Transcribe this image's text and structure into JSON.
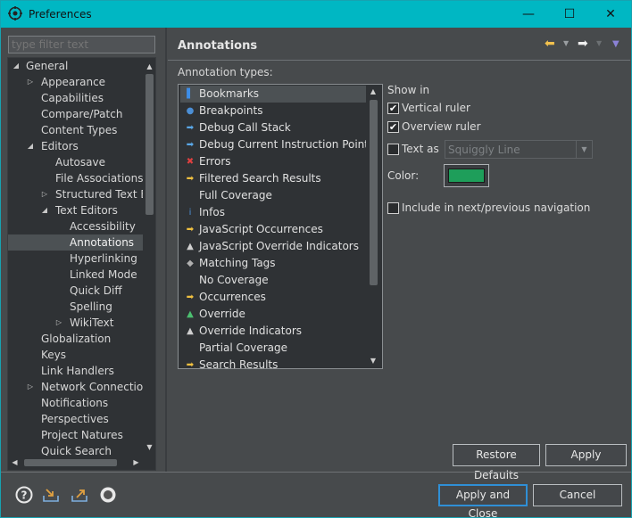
{
  "window": {
    "title": "Preferences",
    "minimize_glyph": "—",
    "maximize_glyph": "☐",
    "close_glyph": "✕"
  },
  "filter": {
    "placeholder": "type filter text"
  },
  "tree": {
    "items": [
      {
        "label": "General",
        "twisty": "expanded",
        "level": 0
      },
      {
        "label": "Appearance",
        "twisty": "collapsed",
        "level": 1
      },
      {
        "label": "Capabilities",
        "twisty": "none",
        "level": 1
      },
      {
        "label": "Compare/Patch",
        "twisty": "none",
        "level": 1
      },
      {
        "label": "Content Types",
        "twisty": "none",
        "level": 1
      },
      {
        "label": "Editors",
        "twisty": "expanded",
        "level": 1
      },
      {
        "label": "Autosave",
        "twisty": "none",
        "level": 2
      },
      {
        "label": "File Associations",
        "twisty": "none",
        "level": 2
      },
      {
        "label": "Structured Text Ed",
        "twisty": "collapsed",
        "level": 2
      },
      {
        "label": "Text Editors",
        "twisty": "expanded",
        "level": 2
      },
      {
        "label": "Accessibility",
        "twisty": "none",
        "level": 3
      },
      {
        "label": "Annotations",
        "twisty": "none",
        "level": 3,
        "selected": true
      },
      {
        "label": "Hyperlinking",
        "twisty": "none",
        "level": 3
      },
      {
        "label": "Linked Mode",
        "twisty": "none",
        "level": 3
      },
      {
        "label": "Quick Diff",
        "twisty": "none",
        "level": 3
      },
      {
        "label": "Spelling",
        "twisty": "none",
        "level": 3
      },
      {
        "label": "WikiText",
        "twisty": "collapsed",
        "level": 3
      },
      {
        "label": "Globalization",
        "twisty": "none",
        "level": 1
      },
      {
        "label": "Keys",
        "twisty": "none",
        "level": 1
      },
      {
        "label": "Link Handlers",
        "twisty": "none",
        "level": 1
      },
      {
        "label": "Network Connection",
        "twisty": "collapsed",
        "level": 1
      },
      {
        "label": "Notifications",
        "twisty": "none",
        "level": 1
      },
      {
        "label": "Perspectives",
        "twisty": "none",
        "level": 1
      },
      {
        "label": "Project Natures",
        "twisty": "none",
        "level": 1
      },
      {
        "label": "Quick Search",
        "twisty": "none",
        "level": 1
      }
    ]
  },
  "page": {
    "title": "Annotations",
    "annotation_types_label": "Annotation types:",
    "annotation_types": [
      {
        "label": "Bookmarks",
        "icon": "bookmark-icon",
        "glyph": "▌",
        "color": "#3d8ee8",
        "selected": true
      },
      {
        "label": "Breakpoints",
        "icon": "breakpoint-icon",
        "glyph": "●",
        "color": "#4c8fd6"
      },
      {
        "label": "Debug Call Stack",
        "icon": "debug-arrow-icon",
        "glyph": "➡",
        "color": "#5aa8e8"
      },
      {
        "label": "Debug Current Instruction Pointer",
        "icon": "debug-arrow-icon",
        "glyph": "➡",
        "color": "#5aa8e8"
      },
      {
        "label": "Errors",
        "icon": "error-icon",
        "glyph": "✖",
        "color": "#e04040"
      },
      {
        "label": "Filtered Search Results",
        "icon": "search-result-icon",
        "glyph": "➡",
        "color": "#f0c040"
      },
      {
        "label": "Full Coverage",
        "icon": "",
        "glyph": "",
        "color": "#cccccc"
      },
      {
        "label": "Infos",
        "icon": "info-icon",
        "glyph": "i",
        "color": "#4c8fd6"
      },
      {
        "label": "JavaScript Occurrences",
        "icon": "occurrence-icon",
        "glyph": "➡",
        "color": "#f0c040"
      },
      {
        "label": "JavaScript Override Indicators",
        "icon": "override-icon",
        "glyph": "▲",
        "color": "#d0d0d0"
      },
      {
        "label": "Matching Tags",
        "icon": "matching-tags-icon",
        "glyph": "◆",
        "color": "#b0b0b0"
      },
      {
        "label": "No Coverage",
        "icon": "",
        "glyph": "",
        "color": "#cccccc"
      },
      {
        "label": "Occurrences",
        "icon": "occurrence-icon",
        "glyph": "➡",
        "color": "#f0c040"
      },
      {
        "label": "Override",
        "icon": "override-icon",
        "glyph": "▲",
        "color": "#4cc070"
      },
      {
        "label": "Override Indicators",
        "icon": "override-icon",
        "glyph": "▲",
        "color": "#d0d0d0"
      },
      {
        "label": "Partial Coverage",
        "icon": "",
        "glyph": "",
        "color": "#cccccc"
      },
      {
        "label": "Search Results",
        "icon": "search-result-icon",
        "glyph": "➡",
        "color": "#f0c040"
      }
    ],
    "show_in_label": "Show in",
    "vertical_ruler": {
      "label": "Vertical ruler",
      "checked": true
    },
    "overview_ruler": {
      "label": "Overview ruler",
      "checked": true
    },
    "text_as": {
      "label": "Text as",
      "checked": false,
      "value": "Squiggly Line"
    },
    "color_label": "Color:",
    "color_value": "#1e9e5a",
    "include_nav": {
      "label": "Include in next/previous navigation",
      "checked": false
    },
    "restore_defaults": "Restore Defaults",
    "apply": "Apply"
  },
  "footer": {
    "apply_and_close": "Apply and Close",
    "cancel": "Cancel"
  },
  "colors": {
    "titlebar": "#00b7c3",
    "background": "#474a4c",
    "list_background": "#2f3235",
    "default_button_border": "#2f8fd6"
  }
}
